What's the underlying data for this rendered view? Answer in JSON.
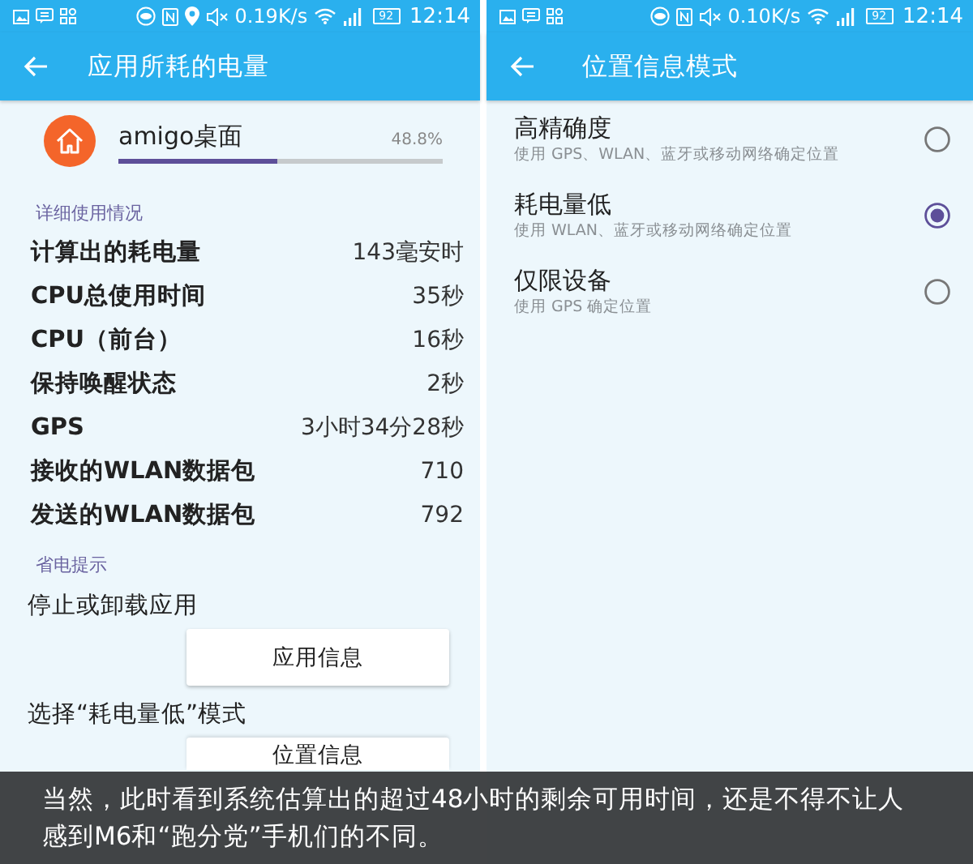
{
  "left_screen": {
    "status_bar": {
      "speed": "0.19K/s",
      "battery": "92",
      "time": "12:14",
      "location": true
    },
    "title": "应用所耗的电量",
    "app": {
      "name": "amigo桌面",
      "percent": "48.8%",
      "level": 0.488
    },
    "details_header": "详细使用情况",
    "details": [
      {
        "label": "计算出的耗电量",
        "value": "143毫安时"
      },
      {
        "label": "CPU总使用时间",
        "value": "35秒"
      },
      {
        "label": "CPU（前台）",
        "value": "16秒"
      },
      {
        "label": "保持唤醒状态",
        "value": "2秒"
      },
      {
        "label": "GPS",
        "value": "3小时34分28秒"
      },
      {
        "label": "接收的WLAN数据包",
        "value": "710"
      },
      {
        "label": "发送的WLAN数据包",
        "value": "792"
      }
    ],
    "tips_header": "省电提示",
    "tips": [
      {
        "text": "停止或卸载应用",
        "button": "应用信息"
      },
      {
        "text": "选择“耗电量低”模式",
        "button": "位置信息"
      }
    ]
  },
  "right_screen": {
    "status_bar": {
      "speed": "0.10K/s",
      "battery": "92",
      "time": "12:14",
      "location": false
    },
    "title": "位置信息模式",
    "modes": [
      {
        "title": "高精确度",
        "description": "使用 GPS、WLAN、蓝牙或移动网络确定位置",
        "selected": false
      },
      {
        "title": "耗电量低",
        "description": "使用 WLAN、蓝牙或移动网络确定位置",
        "selected": true
      },
      {
        "title": "仅限设备",
        "description": "使用 GPS 确定位置",
        "selected": false
      }
    ]
  },
  "caption": {
    "lines": [
      "当然，此时看到系统估算出的超过48小时的剩余可用时间，还是不得不让人",
      "感到M6和“跑分党”手机们的不同。"
    ]
  }
}
